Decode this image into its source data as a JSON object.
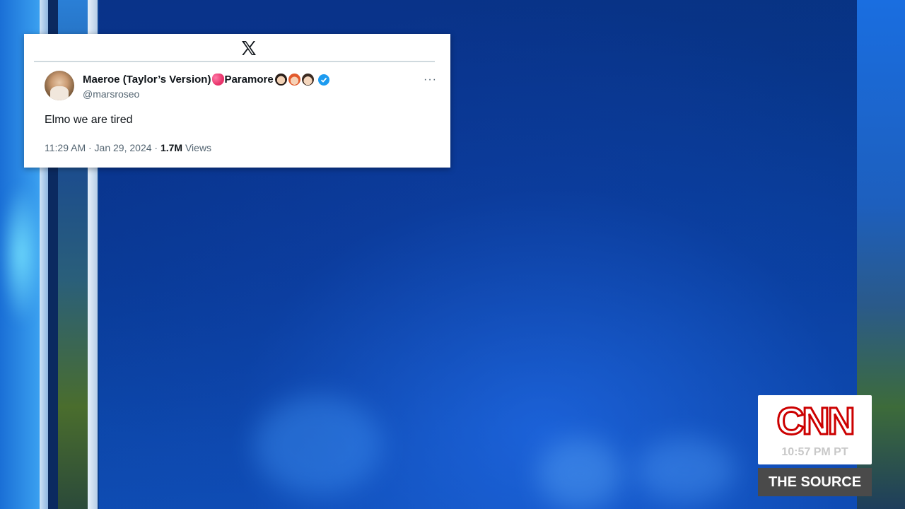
{
  "tweet": {
    "platform_icon": "x-logo-icon",
    "display_name": "Maeroe (Taylor’s Version)",
    "display_name_suffix": "Paramore",
    "name_emoji_icons": [
      "two-hearts-emoji-icon",
      "man-face-emoji-icon",
      "woman-redhair-emoji-icon",
      "man-mustache-emoji-icon"
    ],
    "verified_icon": "verified-badge-icon",
    "handle": "@marsroseo",
    "more_icon": "more-options-icon",
    "text": "Elmo we are tired",
    "time": "11:29 AM · Jan 29, 2024 · ",
    "views_count": "1.7M",
    "views_label": " Views"
  },
  "broadcast": {
    "network_logo": "CNN",
    "time": "10:57 PM PT",
    "show_name": "THE SOURCE"
  },
  "colors": {
    "cnn_red": "#cc0000",
    "verified_blue": "#1d9bf0",
    "background_blue": "#0b4bb0"
  }
}
